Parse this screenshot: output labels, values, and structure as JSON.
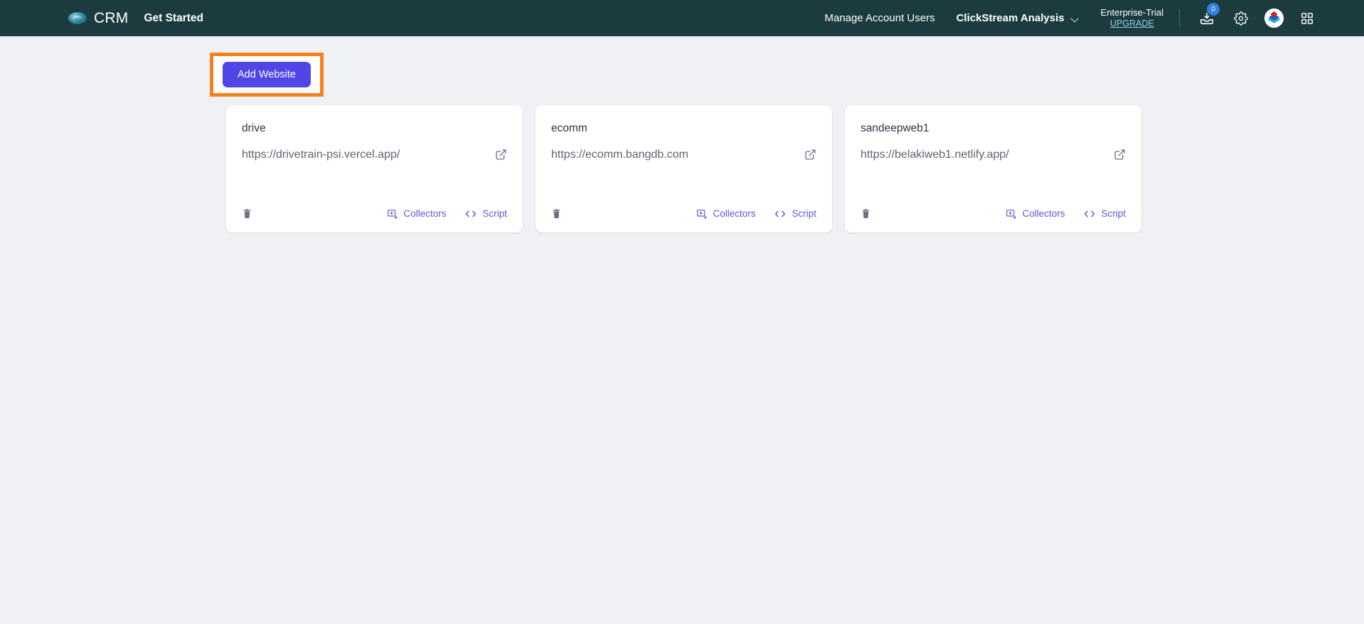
{
  "header": {
    "brand": {
      "logo_icon": "cloud-logo-icon",
      "name": "CRM"
    },
    "get_started_label": "Get Started",
    "manage_account_users_label": "Manage Account Users",
    "clickstream_label": "ClickStream Analysis",
    "clickstream_caret_icon": "chevron-down-icon",
    "plan_name": "Enterprise-Trial",
    "upgrade_label": "UPGRADE",
    "inbox_icon": "inbox-download-icon",
    "inbox_badge_count": "0",
    "settings_icon": "gear-icon",
    "product_logo_icon": "bangdb-logo-icon",
    "apps_icon": "apps-grid-icon"
  },
  "toolbar": {
    "add_website_label": "Add Website",
    "add_website_color": "#4f46e5",
    "highlight_color": "#f5811f"
  },
  "cards": [
    {
      "title": "drive",
      "url": "https://drivetrain-psi.vercel.app/",
      "open_icon": "external-link-icon",
      "delete_icon": "trash-icon",
      "collectors_icon": "add-collector-icon",
      "collectors_label": "Collectors",
      "script_icon": "code-brackets-icon",
      "script_label": "Script"
    },
    {
      "title": "ecomm",
      "url": "https://ecomm.bangdb.com",
      "open_icon": "external-link-icon",
      "delete_icon": "trash-icon",
      "collectors_icon": "add-collector-icon",
      "collectors_label": "Collectors",
      "script_icon": "code-brackets-icon",
      "script_label": "Script"
    },
    {
      "title": "sandeepweb1",
      "url": "https://belakiweb1.netlify.app/",
      "open_icon": "external-link-icon",
      "delete_icon": "trash-icon",
      "collectors_icon": "add-collector-icon",
      "collectors_label": "Collectors",
      "script_icon": "code-brackets-icon",
      "script_label": "Script"
    }
  ],
  "colors": {
    "header_bg": "#1b3b3f",
    "page_bg": "#eff1f5",
    "card_bg": "#ffffff",
    "accent": "#5b5bd6",
    "badge_bg": "#2d7fe0",
    "upgrade_link": "#8fd0e8"
  }
}
